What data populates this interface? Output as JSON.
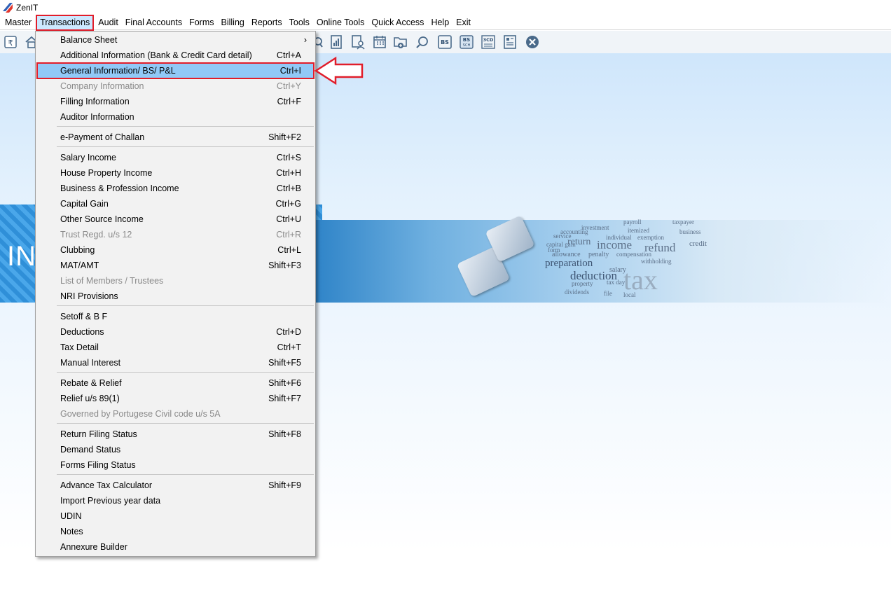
{
  "app": {
    "title": "ZenIT"
  },
  "menubar": {
    "items": [
      "Master",
      "Transactions",
      "Audit",
      "Final Accounts",
      "Forms",
      "Billing",
      "Reports",
      "Tools",
      "Online Tools",
      "Quick Access",
      "Help",
      "Exit"
    ],
    "active": "Transactions"
  },
  "toolbar": {
    "icons": [
      "rupee-book-icon",
      "home-icon",
      "search-doc-icon",
      "report-icon",
      "user-doc-icon",
      "calendar-icon",
      "folder-add-icon",
      "search-circle-icon",
      "bs-icon",
      "bs-sch-icon",
      "3cd-icon",
      "form-icon",
      "close-icon"
    ],
    "labels": {
      "bs": "BS",
      "bs_sch_top": "BS",
      "bs_sch_bottom": "SCH",
      "cd": "3CD"
    }
  },
  "banner": {
    "text": "INC",
    "words": [
      "payroll",
      "investment",
      "itemized",
      "accounting",
      "return",
      "income",
      "refund",
      "individual",
      "penalty",
      "compensation",
      "allowance",
      "preparation",
      "deduction",
      "salary",
      "property",
      "tax day",
      "dividends",
      "file",
      "tax",
      "local",
      "withholding",
      "exemption",
      "business",
      "taxpayer",
      "credit",
      "form",
      "service",
      "capital gain"
    ]
  },
  "transactions_menu": {
    "items": [
      {
        "label": "Balance Sheet",
        "shortcut": "",
        "submenu": true
      },
      {
        "label": "Additional Information (Bank & Credit Card detail)",
        "shortcut": "Ctrl+A"
      },
      {
        "label": "General Information/ BS/ P&L",
        "shortcut": "Ctrl+I",
        "highlighted": true
      },
      {
        "label": "Company Information",
        "shortcut": "Ctrl+Y",
        "disabled": true
      },
      {
        "label": "Filling Information",
        "shortcut": "Ctrl+F"
      },
      {
        "label": "Auditor Information",
        "shortcut": ""
      },
      {
        "label": "e-Payment of Challan",
        "shortcut": "Shift+F2"
      },
      {
        "label": "Salary Income",
        "shortcut": "Ctrl+S"
      },
      {
        "label": "House Property Income",
        "shortcut": "Ctrl+H"
      },
      {
        "label": "Business & Profession Income",
        "shortcut": "Ctrl+B"
      },
      {
        "label": "Capital Gain",
        "shortcut": "Ctrl+G"
      },
      {
        "label": "Other Source Income",
        "shortcut": "Ctrl+U"
      },
      {
        "label": "Trust Regd. u/s 12",
        "shortcut": "Ctrl+R",
        "disabled": true
      },
      {
        "label": "Clubbing",
        "shortcut": "Ctrl+L"
      },
      {
        "label": "MAT/AMT",
        "shortcut": "Shift+F3"
      },
      {
        "label": "List of Members / Trustees",
        "shortcut": "",
        "disabled": true
      },
      {
        "label": "NRI Provisions",
        "shortcut": ""
      },
      {
        "label": "Setoff & B F",
        "shortcut": ""
      },
      {
        "label": "Deductions",
        "shortcut": "Ctrl+D"
      },
      {
        "label": "Tax Detail",
        "shortcut": "Ctrl+T"
      },
      {
        "label": "Manual Interest",
        "shortcut": "Shift+F5"
      },
      {
        "label": "Rebate & Relief",
        "shortcut": "Shift+F6"
      },
      {
        "label": "Relief u/s 89(1)",
        "shortcut": "Shift+F7"
      },
      {
        "label": "Governed by Portugese Civil code u/s 5A",
        "shortcut": "",
        "disabled": true
      },
      {
        "label": "Return Filing Status",
        "shortcut": "Shift+F8"
      },
      {
        "label": "Demand Status",
        "shortcut": ""
      },
      {
        "label": "Forms Filing Status",
        "shortcut": ""
      },
      {
        "label": "Advance Tax Calculator",
        "shortcut": "Shift+F9"
      },
      {
        "label": "Import Previous year data",
        "shortcut": ""
      },
      {
        "label": "UDIN",
        "shortcut": ""
      },
      {
        "label": "Notes",
        "shortcut": ""
      },
      {
        "label": "Annexure Builder",
        "shortcut": ""
      }
    ],
    "submenu_arrow": "›"
  },
  "colors": {
    "highlight": "#91c9f7",
    "annotation_red": "#e11d2a"
  }
}
